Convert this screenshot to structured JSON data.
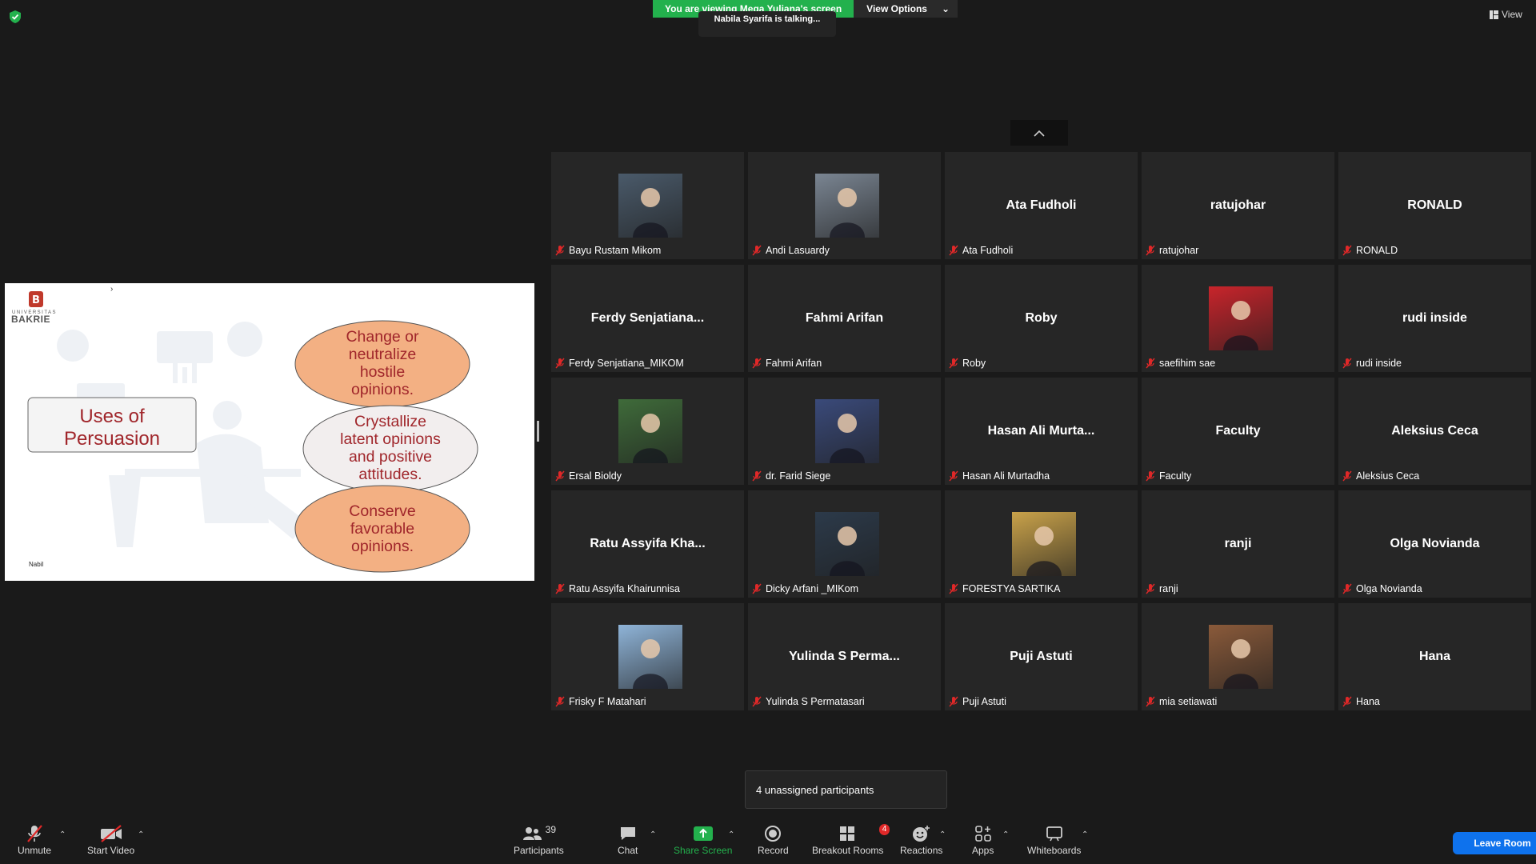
{
  "banner": {
    "viewing": "You are viewing Mega Yuliana's screen",
    "view_options": "View Options",
    "talking": "Nabila Syarifa is talking...",
    "view": "View"
  },
  "slide": {
    "logo_small": "UNIVERSITAS",
    "logo_big": "BAKRIE",
    "title_line1": "Uses of",
    "title_line2": "Persuasion",
    "oval1": [
      "Change or",
      "neutralize",
      "hostile",
      "opinions."
    ],
    "oval2": [
      "Crystallize",
      "latent opinions",
      "and positive",
      "attitudes."
    ],
    "oval3": [
      "Conserve",
      "favorable",
      "opinions."
    ],
    "author": "Nabil"
  },
  "participants": [
    {
      "name": "Bayu Rustam Mikom",
      "display": "",
      "photo": true,
      "photo_color": "#4a5a6a"
    },
    {
      "name": "Andi Lasuardy",
      "display": "",
      "photo": true,
      "photo_color": "#7a8592"
    },
    {
      "name": "Ata Fudholi",
      "display": "Ata Fudholi",
      "photo": false
    },
    {
      "name": "ratujohar",
      "display": "ratujohar",
      "photo": false
    },
    {
      "name": "RONALD",
      "display": "RONALD",
      "photo": false
    },
    {
      "name": "Ferdy Senjatiana_MIKOM",
      "display": "Ferdy  Senjatiana...",
      "photo": false
    },
    {
      "name": "Fahmi Arifan",
      "display": "Fahmi Arifan",
      "photo": false
    },
    {
      "name": "Roby",
      "display": "Roby",
      "photo": false
    },
    {
      "name": "saefihim sae",
      "display": "",
      "photo": true,
      "photo_color": "#c8242b"
    },
    {
      "name": "rudi inside",
      "display": "rudi inside",
      "photo": false
    },
    {
      "name": "Ersal Bioldy",
      "display": "",
      "photo": true,
      "photo_color": "#3f6b3a"
    },
    {
      "name": "dr. Farid Siege",
      "display": "",
      "photo": true,
      "photo_color": "#3a4a7a"
    },
    {
      "name": "Hasan Ali Murtadha",
      "display": "Hasan Ali Murta...",
      "photo": false
    },
    {
      "name": "Faculty",
      "display": "Faculty",
      "photo": false
    },
    {
      "name": "Aleksius Ceca",
      "display": "Aleksius Ceca",
      "photo": false
    },
    {
      "name": "Ratu Assyifa Khairunnisa",
      "display": "Ratu Assyifa  Kha...",
      "photo": false
    },
    {
      "name": "Dicky Arfani _MIKom",
      "display": "",
      "photo": true,
      "photo_color": "#2c3a4a"
    },
    {
      "name": "FORESTYA SARTIKA",
      "display": "",
      "photo": true,
      "photo_color": "#c9a24a"
    },
    {
      "name": "ranji",
      "display": "ranji",
      "photo": false
    },
    {
      "name": "Olga Novianda",
      "display": "Olga Novianda",
      "photo": false
    },
    {
      "name": "Frisky F Matahari",
      "display": "",
      "photo": true,
      "photo_color": "#8fb4d8"
    },
    {
      "name": "Yulinda S Permatasari",
      "display": "Yulinda  S  Perma...",
      "photo": false
    },
    {
      "name": "Puji Astuti",
      "display": "Puji Astuti",
      "photo": false
    },
    {
      "name": "mia setiawati",
      "display": "",
      "photo": true,
      "photo_color": "#8a5a3a"
    },
    {
      "name": "Hana",
      "display": "Hana",
      "photo": false
    }
  ],
  "tooltip": "4 unassigned participants",
  "toolbar": {
    "unmute": "Unmute",
    "start_video": "Start Video",
    "participants": "Participants",
    "participants_count": "39",
    "chat": "Chat",
    "share_screen": "Share Screen",
    "record": "Record",
    "breakout_rooms": "Breakout Rooms",
    "breakout_badge": "4",
    "reactions": "Reactions",
    "apps": "Apps",
    "whiteboards": "Whiteboards",
    "leave": "Leave Room"
  },
  "colors": {
    "share_green": "#23b14d",
    "leave_blue": "#0e72ed",
    "muted_red": "#e02828",
    "oval_orange": "#f3b083",
    "slide_text_red": "#a0262b"
  }
}
